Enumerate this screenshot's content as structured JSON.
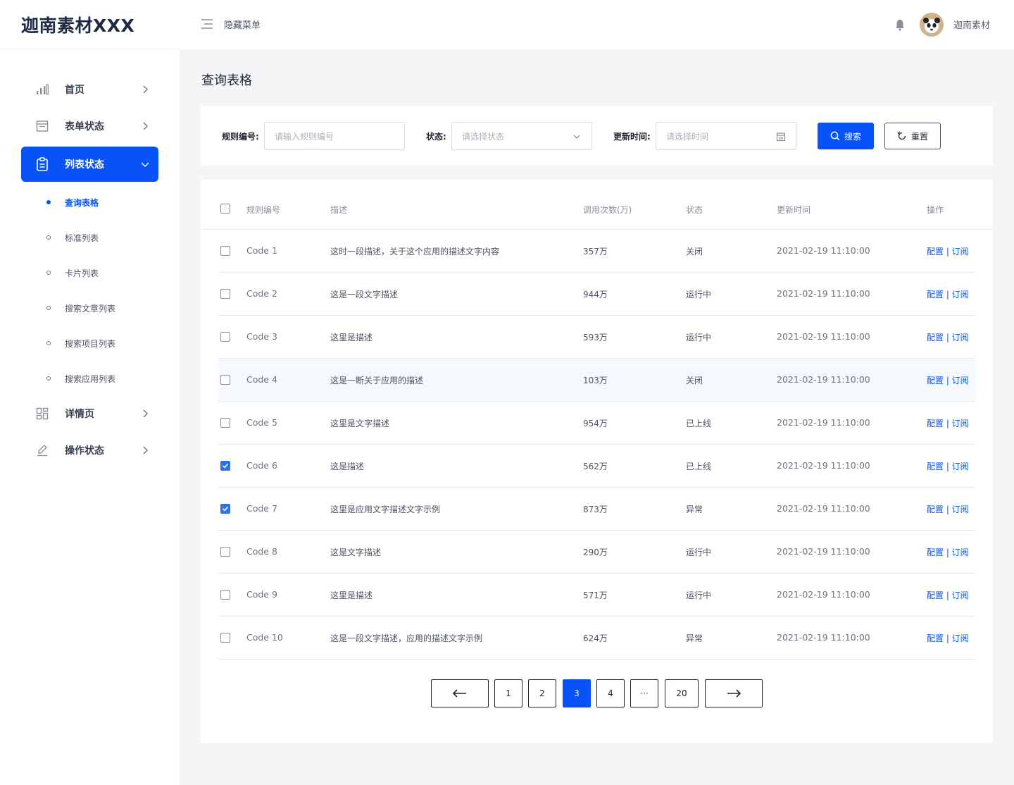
{
  "brand": {
    "logo_text": "迦南素材XXX"
  },
  "header": {
    "hide_menu_label": "隐藏菜单",
    "username": "迦南素材"
  },
  "sidebar": {
    "items": [
      {
        "label": "首页",
        "icon": "bar-chart-icon"
      },
      {
        "label": "表单状态",
        "icon": "form-icon"
      },
      {
        "label": "列表状态",
        "icon": "clipboard-icon",
        "active": true
      },
      {
        "label": "详情页",
        "icon": "dashboard-icon"
      },
      {
        "label": "操作状态",
        "icon": "edit-icon"
      }
    ],
    "submenu": [
      {
        "label": "查询表格",
        "active": true
      },
      {
        "label": "标准列表"
      },
      {
        "label": "卡片列表"
      },
      {
        "label": "搜索文章列表"
      },
      {
        "label": "搜索项目列表"
      },
      {
        "label": "搜索应用列表"
      }
    ]
  },
  "page": {
    "title": "查询表格"
  },
  "search": {
    "rule_label": "规则编号:",
    "rule_placeholder": "请输入规则编号",
    "status_label": "状态:",
    "status_placeholder": "请选择状态",
    "time_label": "更新时间:",
    "time_placeholder": "请选择时间",
    "search_button": "搜索",
    "reset_button": "重置"
  },
  "table": {
    "headers": [
      "规则编号",
      "描述",
      "调用次数(万)",
      "状态",
      "更新时间",
      "操作"
    ],
    "rows": [
      {
        "code": "Code 1",
        "desc": "这时一段描述，关于这个应用的描述文字内容",
        "calls": "357万",
        "status": "关闭",
        "time": "2021-02-19 11:10:00",
        "op": "配置 | 订阅",
        "checked": false
      },
      {
        "code": "Code 2",
        "desc": "这是一段文字描述",
        "calls": "944万",
        "status": "运行中",
        "time": "2021-02-19 11:10:00",
        "op": "配置 | 订阅",
        "checked": false
      },
      {
        "code": "Code 3",
        "desc": "这里是描述",
        "calls": "593万",
        "status": "运行中",
        "time": "2021-02-19 11:10:00",
        "op": "配置 | 订阅",
        "checked": false
      },
      {
        "code": "Code 4",
        "desc": "这是一断关于应用的描述",
        "calls": "103万",
        "status": "关闭",
        "time": "2021-02-19 11:10:00",
        "op": "配置 | 订阅",
        "checked": false,
        "highlight": true
      },
      {
        "code": "Code 5",
        "desc": "这里是文字描述",
        "calls": "954万",
        "status": "已上线",
        "time": "2021-02-19 11:10:00",
        "op": "配置 | 订阅",
        "checked": false
      },
      {
        "code": "Code 6",
        "desc": "这是描述",
        "calls": "562万",
        "status": "已上线",
        "time": "2021-02-19 11:10:00",
        "op": "配置 | 订阅",
        "checked": true
      },
      {
        "code": "Code 7",
        "desc": "这里是应用文字描述文字示例",
        "calls": "873万",
        "status": "异常",
        "time": "2021-02-19 11:10:00",
        "op": "配置 | 订阅",
        "checked": true
      },
      {
        "code": "Code 8",
        "desc": "这是文字描述",
        "calls": "290万",
        "status": "运行中",
        "time": "2021-02-19 11:10:00",
        "op": "配置 | 订阅",
        "checked": false
      },
      {
        "code": "Code 9",
        "desc": "这里是描述",
        "calls": "571万",
        "status": "运行中",
        "time": "2021-02-19 11:10:00",
        "op": "配置 | 订阅",
        "checked": false
      },
      {
        "code": "Code 10",
        "desc": "这是一段文字描述，应用的描述文字示例",
        "calls": "624万",
        "status": "异常",
        "time": "2021-02-19 11:10:00",
        "op": "配置 | 订阅",
        "checked": false
      }
    ]
  },
  "pagination": {
    "pages": [
      "1",
      "2",
      "3",
      "4",
      "···",
      "20"
    ],
    "current": "3"
  },
  "colors": {
    "primary": "#0753f7",
    "checkbox": "#2f6fee"
  }
}
